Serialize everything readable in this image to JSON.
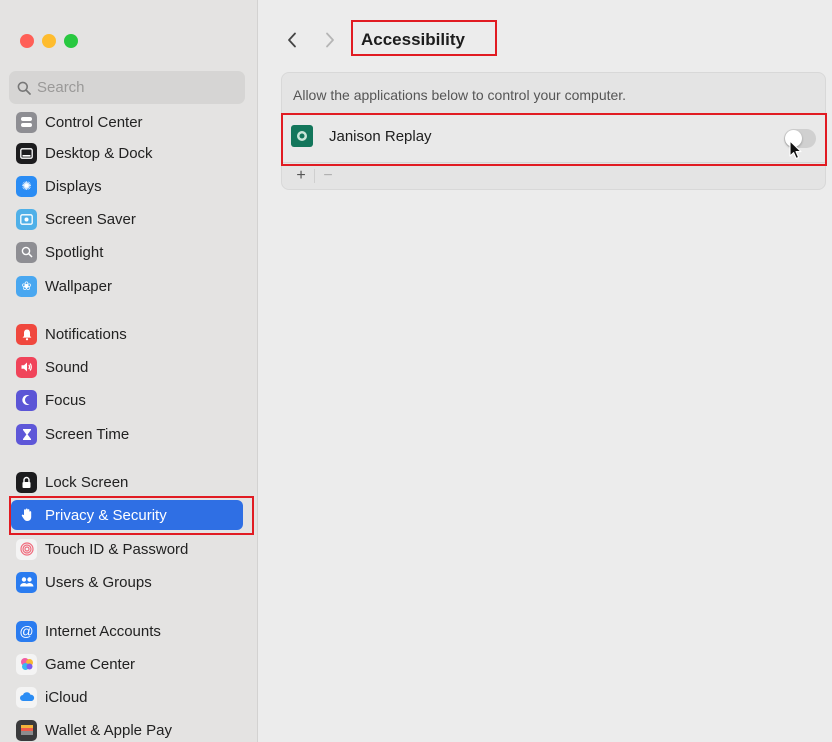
{
  "window": {
    "title": "Accessibility"
  },
  "search": {
    "placeholder": "Search"
  },
  "sidebar": {
    "items": [
      {
        "label": "Control Center",
        "icon": "control-center-icon",
        "color": "#8e8e93"
      },
      {
        "label": "Desktop & Dock",
        "icon": "dock-icon",
        "color": "#1c1c1e"
      },
      {
        "label": "Displays",
        "icon": "sun-icon",
        "color": "#2a8cf4"
      },
      {
        "label": "Screen Saver",
        "icon": "screen-saver-icon",
        "color": "#4fb0e8"
      },
      {
        "label": "Spotlight",
        "icon": "magnifier-icon",
        "color": "#8e8e93"
      },
      {
        "label": "Wallpaper",
        "icon": "flower-icon",
        "color": "#49a7f0"
      },
      {
        "label": "Notifications",
        "icon": "bell-icon",
        "color": "#f0483e"
      },
      {
        "label": "Sound",
        "icon": "speaker-icon",
        "color": "#f0445a"
      },
      {
        "label": "Focus",
        "icon": "moon-icon",
        "color": "#5b55d6"
      },
      {
        "label": "Screen Time",
        "icon": "hourglass-icon",
        "color": "#5e57d8"
      },
      {
        "label": "Lock Screen",
        "icon": "lock-icon",
        "color": "#1c1c1e"
      },
      {
        "label": "Privacy & Security",
        "icon": "hand-icon",
        "color": "#2f6fe4"
      },
      {
        "label": "Touch ID & Password",
        "icon": "fingerprint-icon",
        "color": "#f4f4f4"
      },
      {
        "label": "Users & Groups",
        "icon": "users-icon",
        "color": "#2a7cf0"
      },
      {
        "label": "Internet Accounts",
        "icon": "at-icon",
        "color": "#2a7cf0"
      },
      {
        "label": "Game Center",
        "icon": "game-center-icon",
        "color": "#f4f4f4"
      },
      {
        "label": "iCloud",
        "icon": "cloud-icon",
        "color": "#f4f4f4"
      },
      {
        "label": "Wallet & Apple Pay",
        "icon": "wallet-icon",
        "color": "#3a3a3c"
      }
    ],
    "selected": "Privacy & Security"
  },
  "main": {
    "title": "Accessibility",
    "description": "Allow the applications below to control your computer.",
    "apps": [
      {
        "name": "Janison Replay",
        "enabled": false
      }
    ],
    "add_label": "+",
    "remove_label": "−"
  }
}
